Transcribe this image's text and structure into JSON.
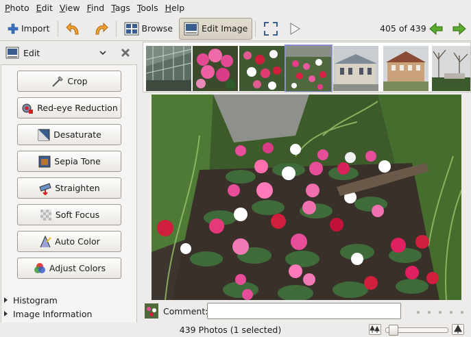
{
  "menu": [
    {
      "mnemonic": "P",
      "rest": "hoto"
    },
    {
      "mnemonic": "E",
      "rest": "dit"
    },
    {
      "mnemonic": "V",
      "rest": "iew"
    },
    {
      "mnemonic": "F",
      "rest": "ind"
    },
    {
      "mnemonic": "T",
      "rest": "ags"
    },
    {
      "mnemonic": "T",
      "rest": "ools"
    },
    {
      "mnemonic": "H",
      "rest": "elp"
    }
  ],
  "toolbar": {
    "import_label": "Import",
    "browse_label": "Browse",
    "edit_image_label": "Edit Image",
    "counter": "405 of 439"
  },
  "sidebar": {
    "mode_label": "Edit",
    "tools": [
      {
        "label": "Crop",
        "icon": "crop-icon"
      },
      {
        "label": "Red-eye Reduction",
        "icon": "red-eye-icon"
      },
      {
        "label": "Desaturate",
        "icon": "desaturate-icon"
      },
      {
        "label": "Sepia Tone",
        "icon": "sepia-icon"
      },
      {
        "label": "Straighten",
        "icon": "straighten-icon"
      },
      {
        "label": "Soft Focus",
        "icon": "soft-focus-icon"
      },
      {
        "label": "Auto Color",
        "icon": "auto-color-icon"
      },
      {
        "label": "Adjust Colors",
        "icon": "adjust-colors-icon"
      }
    ],
    "expanders": [
      "Histogram",
      "Image Information"
    ]
  },
  "main": {
    "comment_label": "Comment:",
    "comment_value": ""
  },
  "status": {
    "text": "439 Photos (1 selected)"
  },
  "colors": {
    "accent_green": "#4a9a2a",
    "selection_outline": "#8a8fd0"
  }
}
